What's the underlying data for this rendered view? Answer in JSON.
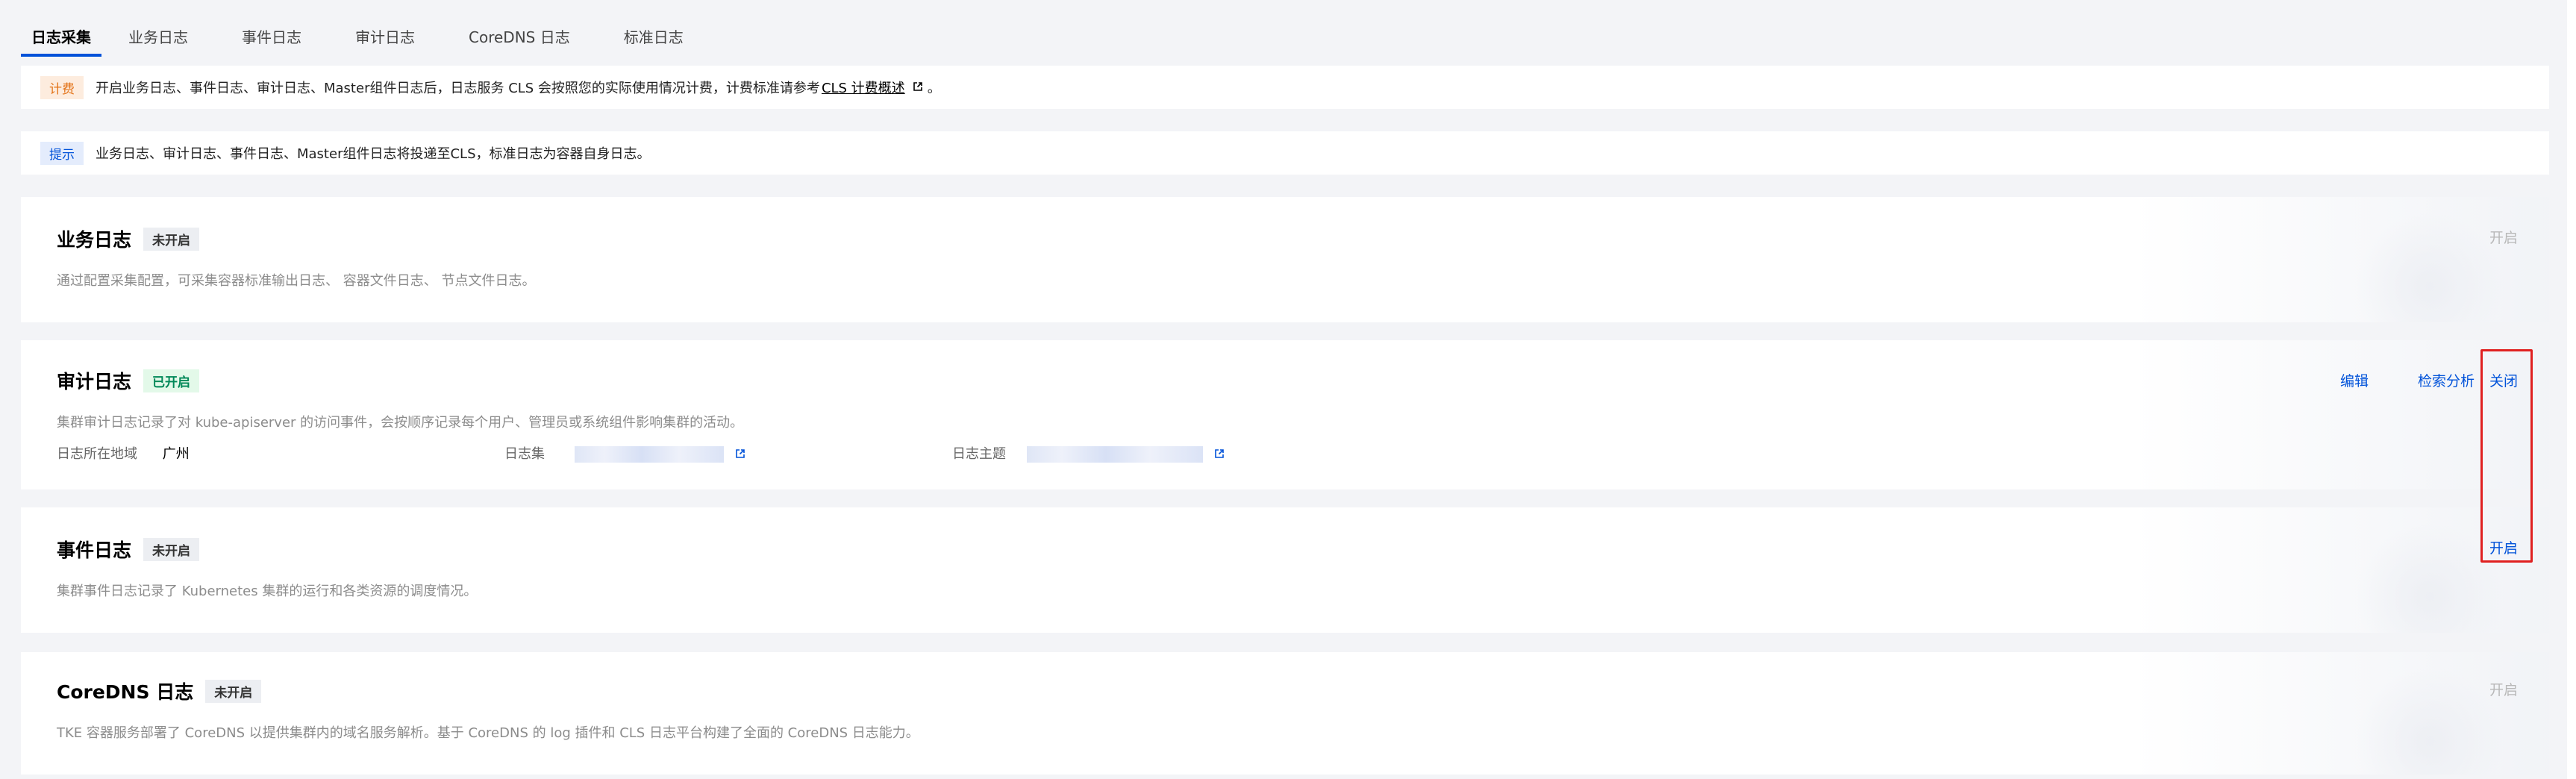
{
  "tabs": [
    {
      "label": "日志采集"
    },
    {
      "label": "业务日志"
    },
    {
      "label": "事件日志"
    },
    {
      "label": "审计日志"
    },
    {
      "label": "CoreDNS 日志"
    },
    {
      "label": "标准日志"
    }
  ],
  "fee_notice": {
    "tag": "计费",
    "text": "开启业务日志、事件日志、审计日志、Master组件日志后，日志服务 CLS 会按照您的实际使用情况计费，计费标准请参考",
    "link": "CLS 计费概述",
    "suffix": "。"
  },
  "tip_notice": {
    "tag": "提示",
    "text": "业务日志、审计日志、事件日志、Master组件日志将投递至CLS，标准日志为容器自身日志。"
  },
  "cards": {
    "business": {
      "title": "业务日志",
      "status": "未开启",
      "desc": "通过配置采集配置，可采集容器标准输出日志、 容器文件日志、 节点文件日志。",
      "action": "开启"
    },
    "audit": {
      "title": "审计日志",
      "status": "已开启",
      "desc": "集群审计日志记录了对 kube-apiserver 的访问事件，会按顺序记录每个用户、管理员或系统组件影响集群的活动。",
      "actions": {
        "edit": "编辑",
        "search": "检索分析",
        "close": "关闭"
      },
      "region_label": "日志所在地域",
      "region_value": "广州",
      "logset_label": "日志集",
      "topic_label": "日志主题"
    },
    "event": {
      "title": "事件日志",
      "status": "未开启",
      "desc": "集群事件日志记录了 Kubernetes 集群的运行和各类资源的调度情况。",
      "action": "开启"
    },
    "coredns": {
      "title": "CoreDNS 日志",
      "status": "未开启",
      "desc": "TKE 容器服务部署了 CoreDNS 以提供集群内的域名服务解析。基于 CoreDNS 的 log 插件和 CLS 日志平台构建了全面的 CoreDNS 日志能力。",
      "action": "开启"
    }
  },
  "colors": {
    "accent": "#0052d9",
    "highlight": "#e02020"
  }
}
